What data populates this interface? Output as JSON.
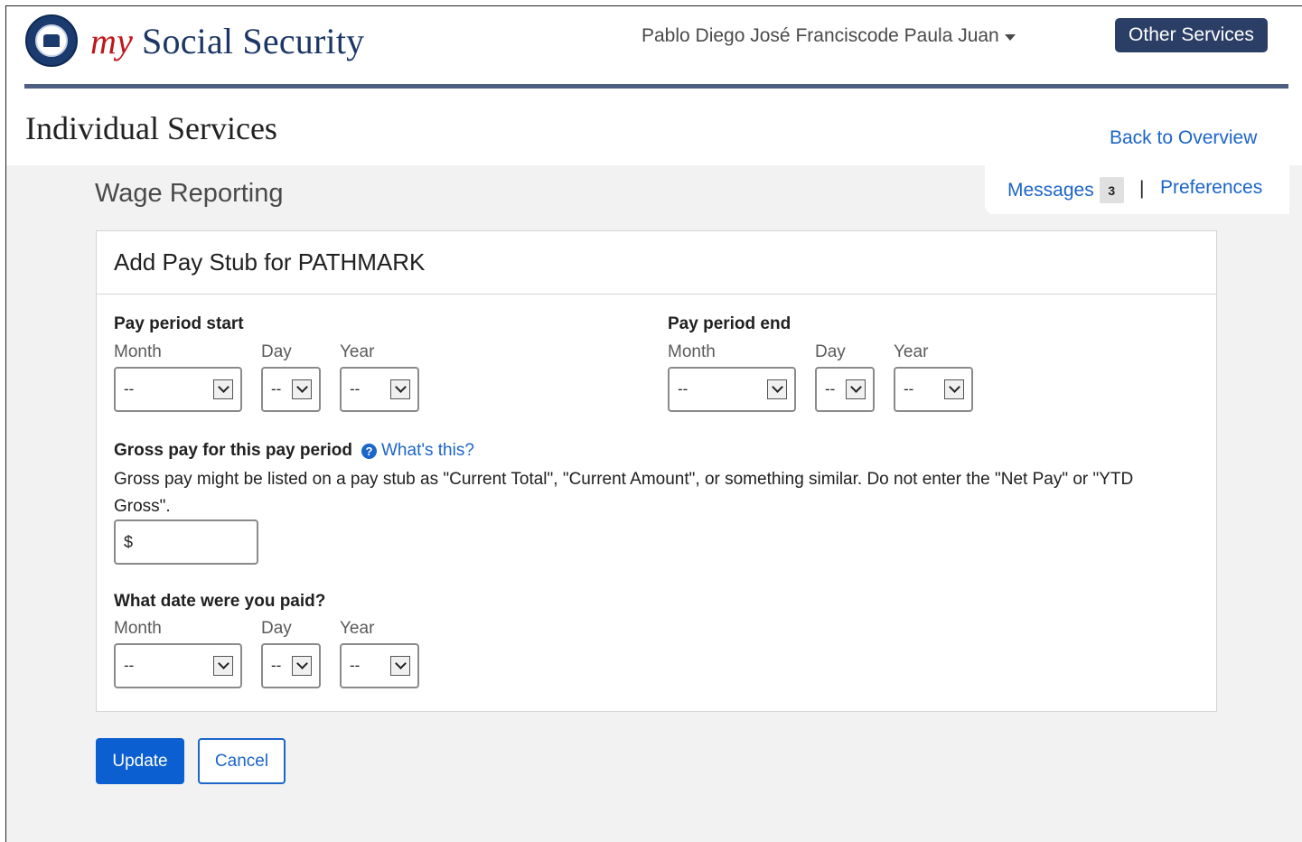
{
  "header": {
    "brand_my": "my",
    "brand_name": "Social Security",
    "user_name": "Pablo Diego José Franciscode Paula Juan",
    "other_services": "Other Services"
  },
  "page": {
    "title": "Individual Services",
    "back_link": "Back to Overview",
    "messages_label": "Messages",
    "messages_count": "3",
    "separator": "|",
    "preferences_label": "Preferences",
    "section_title": "Wage Reporting"
  },
  "form": {
    "card_title": "Add Pay Stub for PATHMARK",
    "pay_start": {
      "label": "Pay period start",
      "month_label": "Month",
      "day_label": "Day",
      "year_label": "Year",
      "month_value": "--",
      "day_value": "--",
      "year_value": "--"
    },
    "pay_end": {
      "label": "Pay period end",
      "month_label": "Month",
      "day_label": "Day",
      "year_label": "Year",
      "month_value": "--",
      "day_value": "--",
      "year_value": "--"
    },
    "gross": {
      "label": "Gross pay for this pay period",
      "help_icon": "?",
      "help_link": "What's this?",
      "help_text": "Gross pay might be listed on a pay stub as \"Current Total\", \"Current Amount\", or something similar. Do not enter the \"Net Pay\" or \"YTD Gross\".",
      "currency": "$"
    },
    "paid_date": {
      "label": "What date were you paid?",
      "month_label": "Month",
      "day_label": "Day",
      "year_label": "Year",
      "month_value": "--",
      "day_value": "--",
      "year_value": "--"
    }
  },
  "actions": {
    "update": "Update",
    "cancel": "Cancel"
  },
  "colors": {
    "brand_navy": "#1c3766",
    "brand_red": "#c0161b",
    "link_blue": "#1c65c9",
    "primary_button": "#0b5fd0",
    "header_button": "#2b3f66"
  }
}
